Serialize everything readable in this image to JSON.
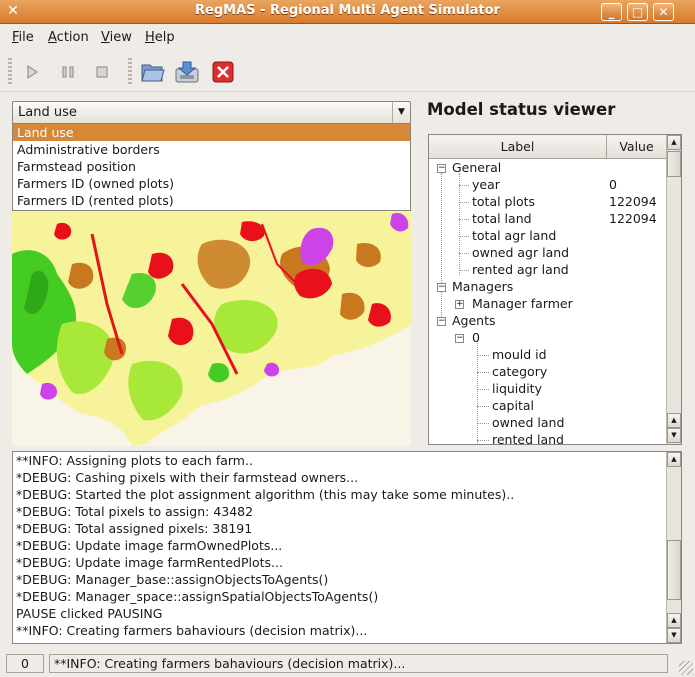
{
  "window": {
    "title": "RegMAS - Regional Multi Agent Simulator"
  },
  "menubar": {
    "items": [
      "File",
      "Action",
      "View",
      "Help"
    ],
    "underline": [
      "F",
      "A",
      "V",
      "H"
    ],
    "rest": [
      "ile",
      "ction",
      "iew",
      "elp"
    ]
  },
  "toolbar": {
    "buttons": [
      "play-icon",
      "pause-icon",
      "stop-icon",
      "open-folder-icon",
      "save-icon",
      "close-red-icon"
    ]
  },
  "layer_select": {
    "selected": "Land use",
    "options": [
      "Land use",
      "Administrative borders",
      "Farmstead position",
      "Farmers ID (owned plots)",
      "Farmers ID (rented plots)"
    ]
  },
  "status_viewer": {
    "title": "Model status viewer",
    "columns": [
      "Label",
      "Value"
    ],
    "general": {
      "label": "General",
      "rows": [
        {
          "label": "year",
          "value": "0"
        },
        {
          "label": "total plots",
          "value": "122094"
        },
        {
          "label": "total land",
          "value": "122094"
        },
        {
          "label": "total agr land",
          "value": ""
        },
        {
          "label": "owned agr land",
          "value": ""
        },
        {
          "label": "rented agr land",
          "value": ""
        }
      ]
    },
    "managers": {
      "label": "Managers",
      "child": "Manager farmer"
    },
    "agents": {
      "label": "Agents",
      "child": "0",
      "rows": [
        "mould id",
        "category",
        "liquidity",
        "capital",
        "owned land",
        "rented land"
      ]
    }
  },
  "log": {
    "lines": [
      "**INFO: Assigning plots to each farm..",
      "*DEBUG: Cashing pixels with their farmstead owners...",
      "*DEBUG: Started the plot assignment algorithm (this may take some minutes)..",
      "*DEBUG: Total pixels to assign: 43482",
      "*DEBUG: Total assigned pixels: 38191",
      "*DEBUG: Update image farmOwnedPlots...",
      "*DEBUG: Update image farmRentedPlots...",
      "*DEBUG: Manager_base::assignObjectsToAgents()",
      "*DEBUG: Manager_space::assignSpatialObjectsToAgents()",
      "PAUSE clicked PAUSING",
      "**INFO: Creating farmers bahaviours (decision matrix)..."
    ]
  },
  "statusbar": {
    "count": "0",
    "message": "**INFO: Creating farmers bahaviours (decision matrix)..."
  },
  "colors": {
    "accent": "#d68838",
    "map_base": "#f7f39a",
    "urban": "#e8101a",
    "forest": "#44cc22",
    "crops": "#c8781e",
    "pasture": "#a8e838",
    "special": "#cc44e8"
  }
}
